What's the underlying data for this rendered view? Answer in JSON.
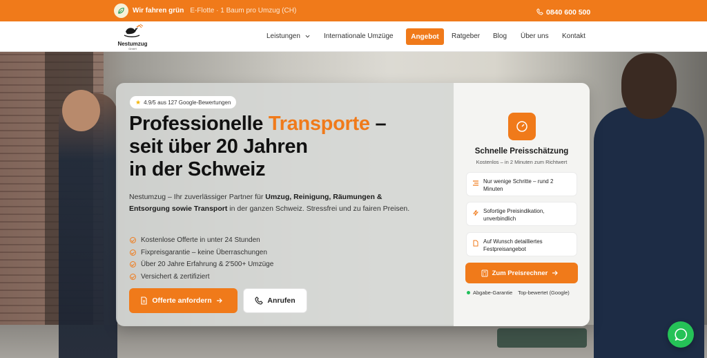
{
  "topbar": {
    "green_label": "Wir fahren grün",
    "subline": "E-Flotte · 1 Baum pro Umzug (CH)",
    "phone": "0840 600 500",
    "icons": {
      "leaf": "leaf-icon",
      "phone": "phone-icon"
    }
  },
  "logo": {
    "name": "Nestumzug",
    "sub": "GmbH"
  },
  "nav": {
    "items": [
      "Leistungen",
      "Internationale Umzüge",
      "Angebot",
      "Ratgeber",
      "Blog",
      "Über uns",
      "Kontakt"
    ],
    "active": "Angebot"
  },
  "hero": {
    "rating": "4.9/5 aus 127 Google-Bewertungen",
    "headline_pre": "Professionelle ",
    "headline_accent": "Transporte",
    "headline_post": " –",
    "headline_line2": "seit über 20 Jahren",
    "headline_line3": "in der Schweiz",
    "lead_1": "Nestumzug – Ihr zuverlässiger Partner für ",
    "lead_bold_1": "Umzug, Reinigung, Räumungen & Entsorgung sowie Transport",
    "lead_2": " in der ganzen Schweiz. Stressfrei und zu fairen Preisen.",
    "checks": [
      "Kostenlose Offerte in unter 24 Stunden",
      "Fixpreisgarantie – keine Überraschungen",
      "Über 20 Jahre Erfahrung & 2'500+ Umzüge",
      "Versichert & zertifiziert"
    ],
    "cta_primary": "Offerte anfordern",
    "cta_secondary": "Anrufen"
  },
  "estimator": {
    "title": "Schnelle Preisschätzung",
    "subtitle": "Kostenlos – in 2 Minuten zum Richtwert",
    "features": [
      {
        "icon": "steps-icon",
        "text": "Nur wenige Schritte – rund 2 Minuten"
      },
      {
        "icon": "lightning-icon",
        "text": "Sofortige Preisindikation, unverbindlich"
      },
      {
        "icon": "document-icon",
        "text": "Auf Wunsch detailliertes Festpreisangebot"
      }
    ],
    "button": "Zum Preisrechner",
    "foot_1": "Abgabe-Garantie",
    "foot_2": "Top-bewertet (Google)"
  },
  "colors": {
    "accent": "#f07a1a",
    "whatsapp": "#25c257"
  }
}
